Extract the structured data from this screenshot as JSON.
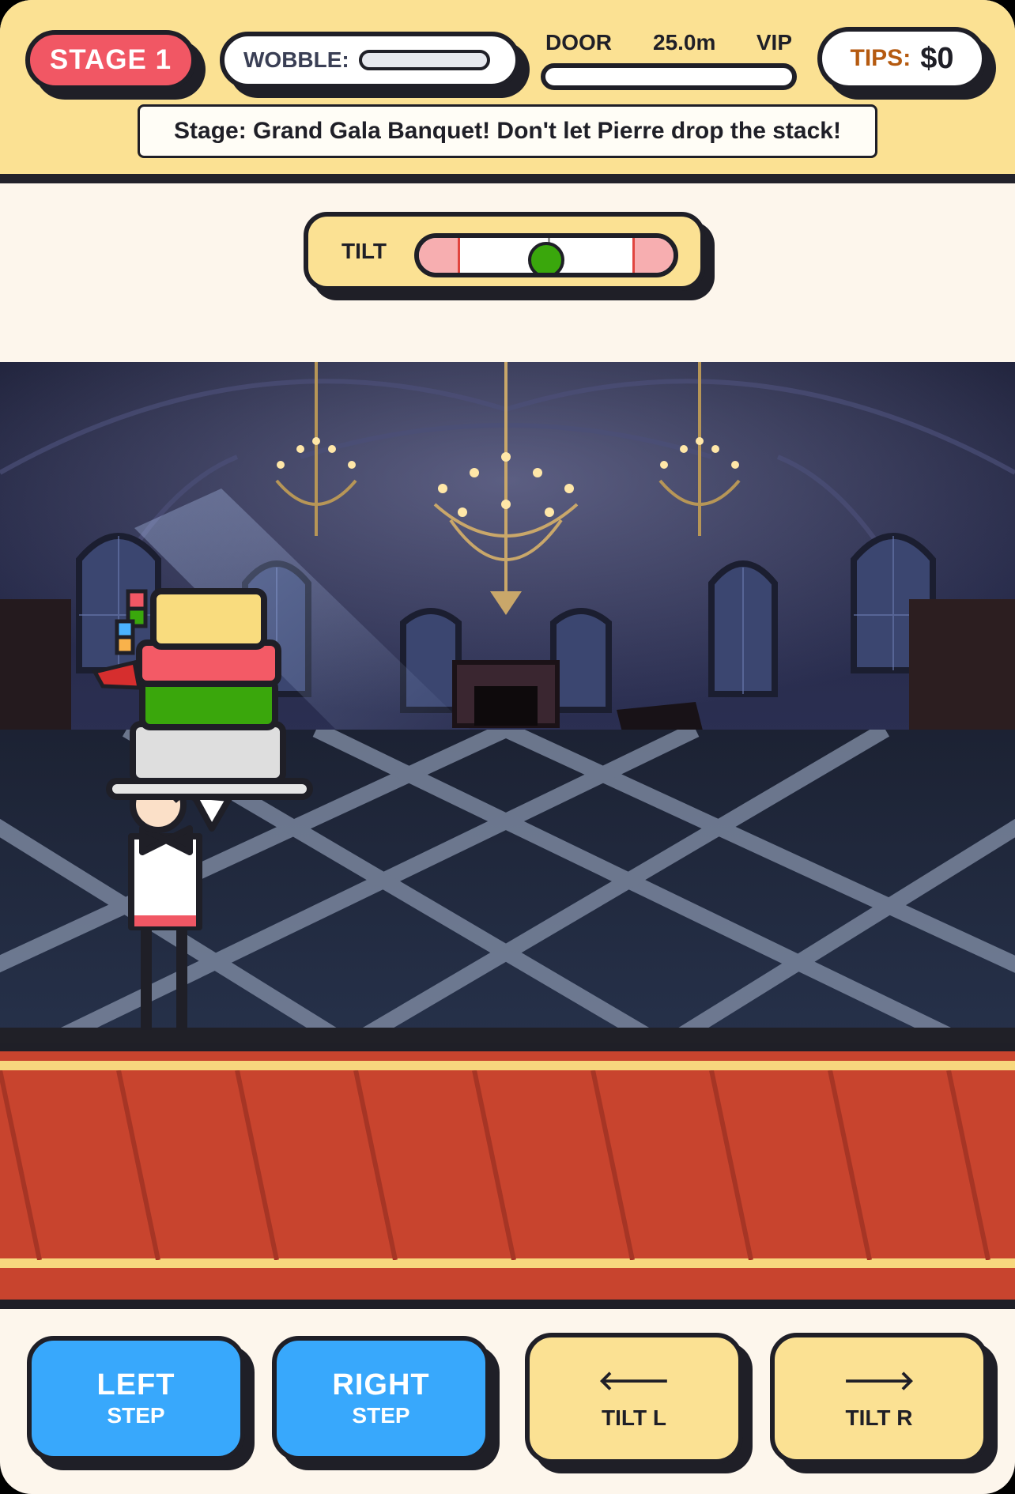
{
  "hud": {
    "stage_label": "STAGE 1",
    "wobble_label": "WOBBLE:",
    "wobble_level": 0,
    "door_label": "DOOR",
    "distance": "25.0m",
    "vip_label": "VIP",
    "door_progress": 0,
    "tips_label": "TIPS:",
    "tips_value": "$0",
    "stage_message": "Stage: Grand Gala Banquet! Don't let Pierre drop the stack!"
  },
  "tilt": {
    "label": "TILT",
    "value": 0
  },
  "scene": {
    "background": "dark grand ballroom with chandeliers",
    "character": "waiter carrying stacked dishes",
    "stack_colors": [
      "#f9dc7e",
      "#f35a66",
      "#3aa70c",
      "#dedede"
    ]
  },
  "controls": {
    "left": {
      "main": "LEFT",
      "sub": "STEP"
    },
    "right": {
      "main": "RIGHT",
      "sub": "STEP"
    },
    "tilt_left": {
      "icon": "arrow-left-icon",
      "glyph": "🡐",
      "label": "TILT L"
    },
    "tilt_right": {
      "icon": "arrow-right-icon",
      "glyph": "🡒",
      "label": "TILT R"
    }
  },
  "colors": {
    "hud_bg": "#fbe193",
    "stage_badge": "#f15764",
    "button_blue": "#38a8fc",
    "button_yellow": "#fbe193",
    "floor_red": "#c8442e",
    "outline": "#1f1f27"
  }
}
